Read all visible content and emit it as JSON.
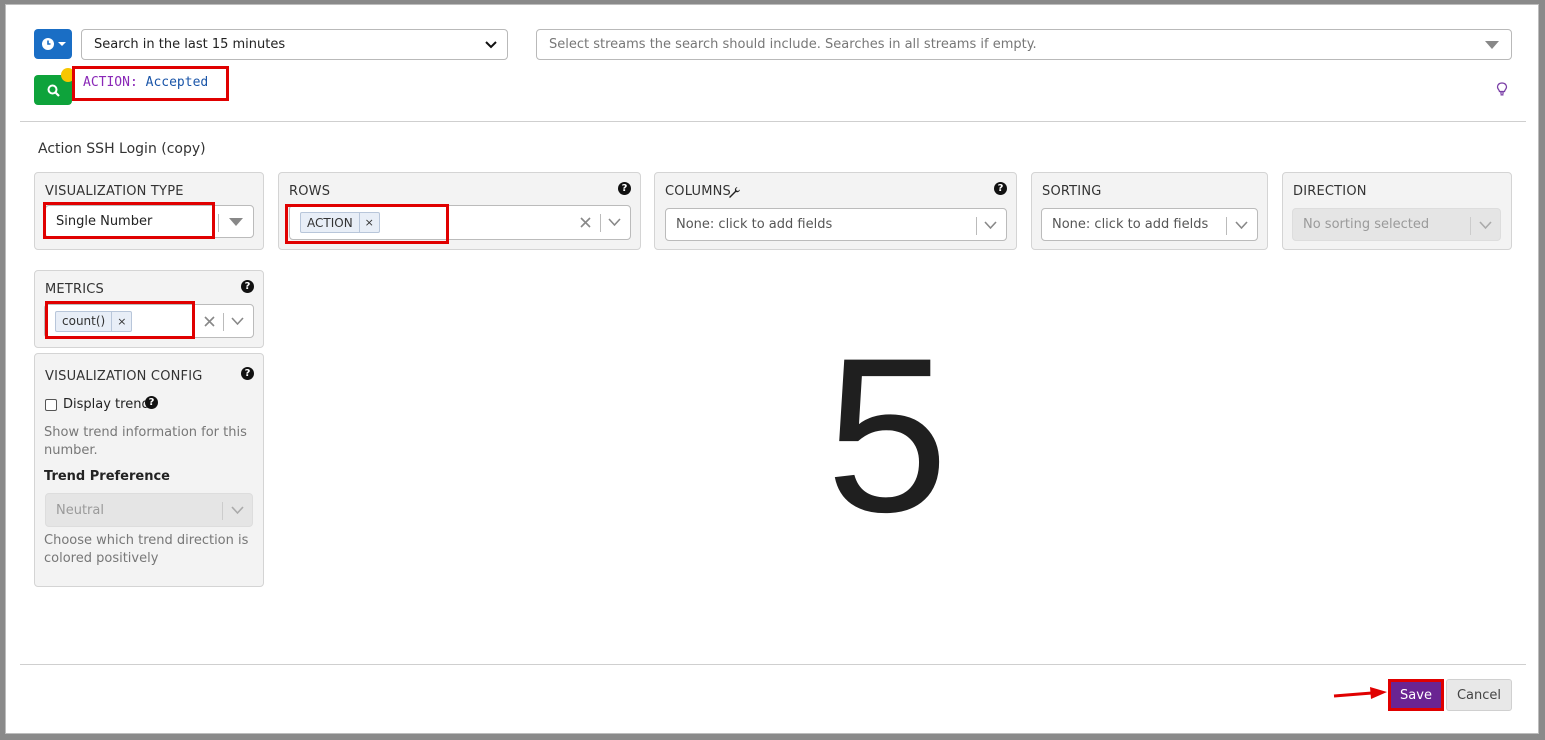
{
  "search": {
    "timerange_label": "Search in the last 15 minutes",
    "streams_placeholder": "Select streams the search should include. Searches in all streams if empty.",
    "query_key": "ACTION:",
    "query_value": "Accepted"
  },
  "widget": {
    "title": "Action SSH Login (copy)"
  },
  "controls": {
    "visualization_type": {
      "label": "VISUALIZATION TYPE",
      "value": "Single Number"
    },
    "rows": {
      "label": "ROWS",
      "tag": "ACTION",
      "tag_remove": "×"
    },
    "columns": {
      "label": "COLUMNS",
      "placeholder": "None: click to add fields"
    },
    "sorting": {
      "label": "SORTING",
      "placeholder": "None: click to add fields"
    },
    "direction": {
      "label": "DIRECTION",
      "placeholder": "No sorting selected"
    },
    "metrics": {
      "label": "METRICS",
      "tag": "count()",
      "tag_remove": "×"
    },
    "visualization_config": {
      "label": "VISUALIZATION CONFIG",
      "display_trend_label": "Display trend",
      "display_trend_help": "Show trend information for this number.",
      "trend_preference_label": "Trend Preference",
      "trend_preference_value": "Neutral",
      "trend_preference_help": "Choose which trend direction is colored positively"
    }
  },
  "result": {
    "value": "5"
  },
  "footer": {
    "save_label": "Save",
    "cancel_label": "Cancel"
  },
  "colors": {
    "accent_save": "#6a2492",
    "highlight": "#e00000",
    "time_button": "#1a6ec5",
    "search_button": "#0ea33b"
  }
}
